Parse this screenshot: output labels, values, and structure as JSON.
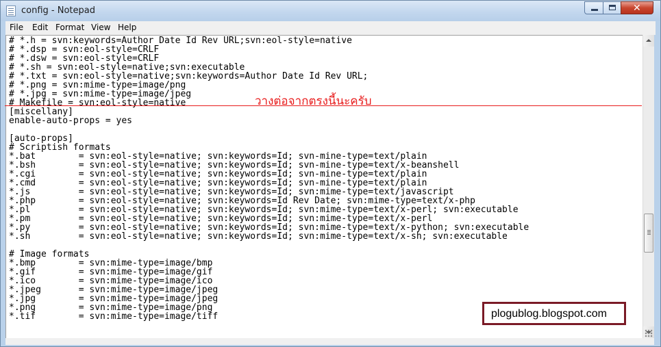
{
  "window": {
    "title": "config - Notepad",
    "close_symbol": "✕"
  },
  "menu": [
    {
      "label": "File"
    },
    {
      "label": "Edit"
    },
    {
      "label": "Format"
    },
    {
      "label": "View"
    },
    {
      "label": "Help"
    }
  ],
  "editor": {
    "lines": [
      "# *.h = svn:keywords=Author Date Id Rev URL;svn:eol-style=native",
      "# *.dsp = svn:eol-style=CRLF",
      "# *.dsw = svn:eol-style=CRLF",
      "# *.sh = svn:eol-style=native;svn:executable",
      "# *.txt = svn:eol-style=native;svn:keywords=Author Date Id Rev URL;",
      "# *.png = svn:mime-type=image/png",
      "# *.jpg = svn:mime-type=image/jpeg",
      "# Makefile = svn:eol-style=native",
      "[miscellany]",
      "enable-auto-props = yes",
      "",
      "[auto-props]",
      "# Scriptish formats",
      "*.bat        = svn:eol-style=native; svn:keywords=Id; svn-mine-type=text/plain",
      "*.bsh        = svn:eol-style=native; svn:keywords=Id; svn-mine-type=text/x-beanshell",
      "*.cgi        = svn:eol-style=native; svn:keywords=Id; svn-mine-type=text/plain",
      "*.cmd        = svn:eol-style=native; svn:keywords=Id; svn-mine-type=text/plain",
      "*.js         = svn:eol-style=native; svn:keywords=Id; svn:mime-type=text/javascript",
      "*.php        = svn:eol-style=native; svn:keywords=Id Rev Date; svn:mime-type=text/x-php",
      "*.pl         = svn:eol-style=native; svn:keywords=Id; svn:mime-type=text/x-perl; svn:executable",
      "*.pm         = svn:eol-style=native; svn:keywords=Id; svn:mime-type=text/x-perl",
      "*.py         = svn:eol-style=native; svn:keywords=Id; svn:mime-type=text/x-python; svn:executable",
      "*.sh         = svn:eol-style=native; svn:keywords=Id; svn:mime-type=text/x-sh; svn:executable",
      "",
      "# Image formats",
      "*.bmp        = svn:mime-type=image/bmp",
      "*.gif        = svn:mime-type=image/gif",
      "*.ico        = svn:mime-type=image/ico",
      "*.jpeg       = svn:mime-type=image/jpeg",
      "*.jpg        = svn:mime-type=image/jpeg",
      "*.png        = svn:mime-type=image/png",
      "*.tif        = svn:mime-type=image/tiff"
    ]
  },
  "annotations": {
    "paste_note": "วางต่อจากตรงนี้นะครับ",
    "note_color": "#e81c1c",
    "watermark": "plogublog.blogspot.com"
  }
}
